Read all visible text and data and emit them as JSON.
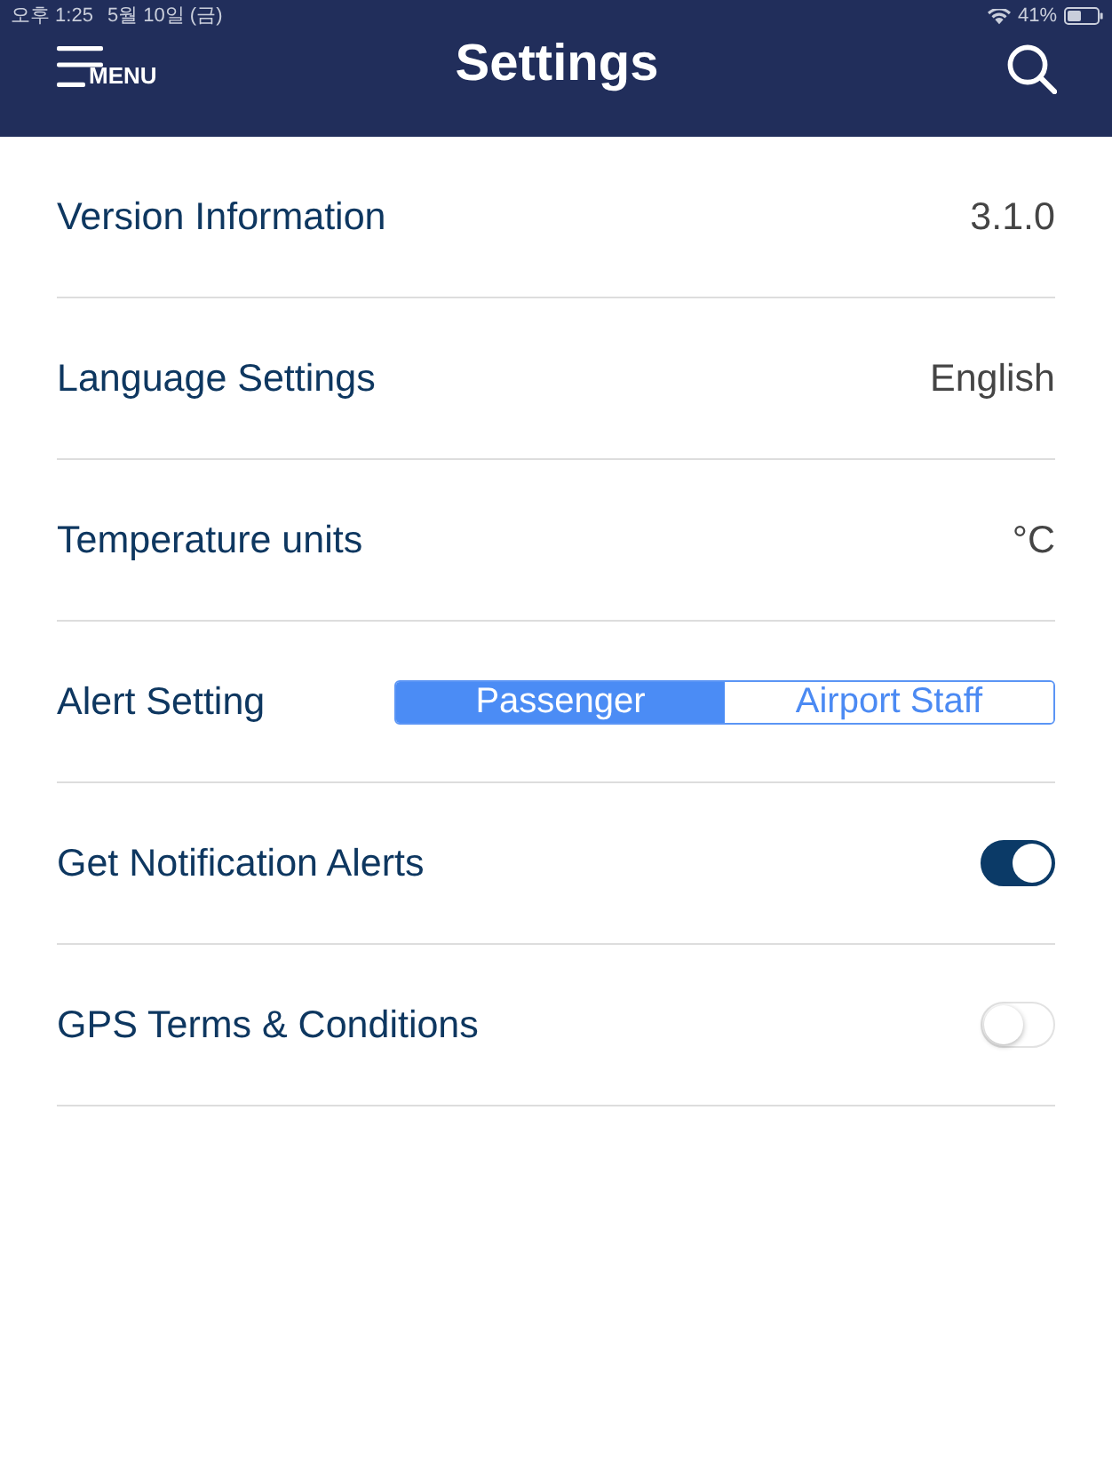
{
  "status_bar": {
    "time": "오후 1:25",
    "date": "5월 10일 (금)",
    "battery": "41%"
  },
  "header": {
    "menu_label": "MENU",
    "title": "Settings"
  },
  "settings": [
    {
      "kind": "value",
      "label": "Version Information",
      "value": "3.1.0"
    },
    {
      "kind": "value",
      "label": "Language Settings",
      "value": "English"
    },
    {
      "kind": "value",
      "label": "Temperature units",
      "value": "°C"
    },
    {
      "kind": "segmented",
      "label": "Alert Setting",
      "options": [
        {
          "label": "Passenger",
          "selected": true
        },
        {
          "label": "Airport Staff",
          "selected": false
        }
      ]
    },
    {
      "kind": "toggle",
      "label": "Get Notification Alerts",
      "on": true
    },
    {
      "kind": "toggle",
      "label": "GPS Terms & Conditions",
      "on": false
    }
  ]
}
